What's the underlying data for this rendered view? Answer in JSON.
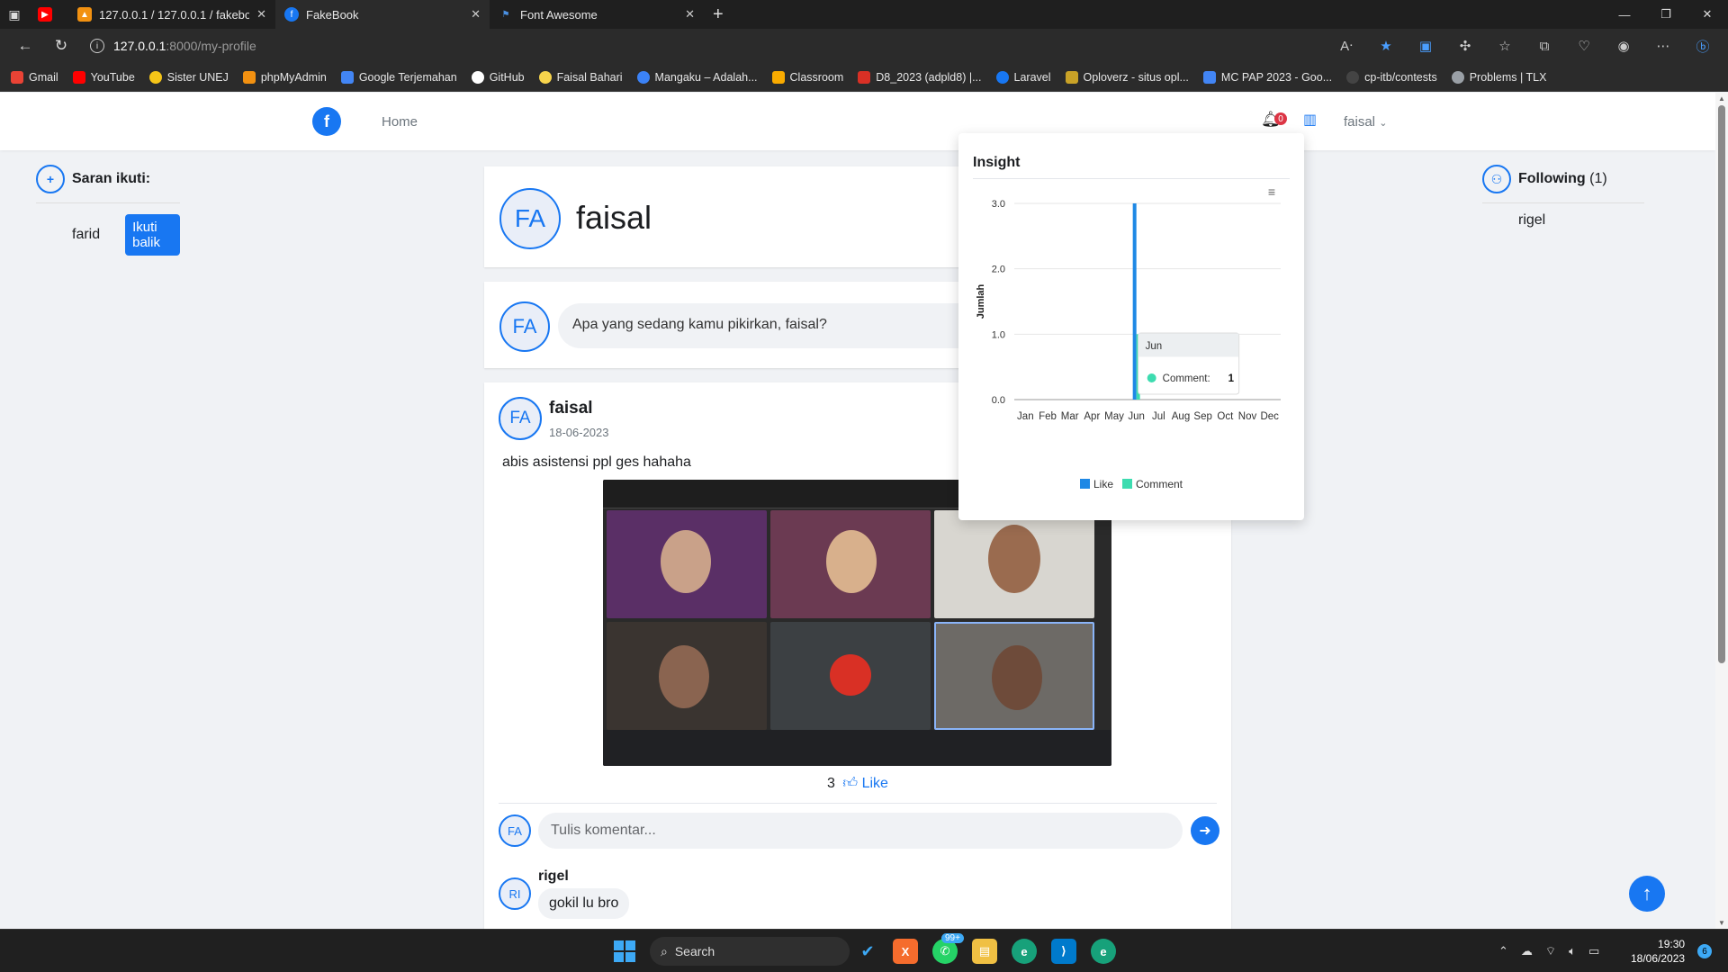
{
  "browser": {
    "tabs": [
      {
        "title": "",
        "favicon": "youtube-icon"
      },
      {
        "title": "127.0.0.1 / 127.0.0.1 / fakebook /",
        "favicon": "phpmyadmin-icon"
      },
      {
        "title": "FakeBook",
        "favicon": "fakebook-icon",
        "active": true
      },
      {
        "title": "Font Awesome",
        "favicon": "flag-icon"
      }
    ],
    "url_host": "127.0.0.1",
    "url_path": ":8000/my-profile",
    "bookmarks": [
      {
        "label": "Gmail",
        "color": "#ea4335"
      },
      {
        "label": "YouTube",
        "color": "#ff0000"
      },
      {
        "label": "Sister UNEJ",
        "color": "#f5c518"
      },
      {
        "label": "phpMyAdmin",
        "color": "#f29111"
      },
      {
        "label": "Google Terjemahan",
        "color": "#4285f4"
      },
      {
        "label": "GitHub",
        "color": "#ffffff"
      },
      {
        "label": "Faisal Bahari",
        "color": "#f7d44c"
      },
      {
        "label": "Mangaku – Adalah...",
        "color": "#3b82f6"
      },
      {
        "label": "Classroom",
        "color": "#f9ab00"
      },
      {
        "label": "D8_2023 (adpld8) |...",
        "color": "#d93025"
      },
      {
        "label": "Laravel",
        "color": "#1877f2"
      },
      {
        "label": "Oploverz - situs opl...",
        "color": "#c9a227"
      },
      {
        "label": "MC PAP 2023 - Goo...",
        "color": "#4285f4"
      },
      {
        "label": "cp-itb/contests",
        "color": "#444444"
      },
      {
        "label": "Problems | TLX",
        "color": "#9aa0a6"
      }
    ]
  },
  "navbar": {
    "home": "Home",
    "notif_count": "0",
    "user": "faisal"
  },
  "saran": {
    "title": "Saran ikuti:",
    "name": "farid",
    "button": "Ikuti balik"
  },
  "following": {
    "title": "Following",
    "count": "(1)",
    "items": [
      "rigel"
    ]
  },
  "profile": {
    "initials": "FA",
    "name": "faisal"
  },
  "compose": {
    "initials": "FA",
    "placeholder": "Apa yang sedang kamu pikirkan, faisal?"
  },
  "post": {
    "initials": "FA",
    "author": "faisal",
    "date": "18-06-2023",
    "text": "abis asistensi ppl ges hahaha",
    "likes": "3",
    "like_label": "Like",
    "comment_initials": "FA",
    "comment_placeholder": "Tulis komentar...",
    "comments": [
      {
        "initials": "RI",
        "author": "rigel",
        "text": "gokil lu bro"
      }
    ]
  },
  "insight": {
    "title": "Insight",
    "tooltip_title": "Jun",
    "tooltip_label": "Comment:",
    "tooltip_value": "1"
  },
  "chart_data": {
    "type": "bar",
    "categories": [
      "Jan",
      "Feb",
      "Mar",
      "Apr",
      "May",
      "Jun",
      "Jul",
      "Aug",
      "Sep",
      "Oct",
      "Nov",
      "Dec"
    ],
    "series": [
      {
        "name": "Like",
        "values": [
          0,
          0,
          0,
          0,
          0,
          3,
          0,
          0,
          0,
          0,
          0,
          0
        ],
        "color": "#1e88e5"
      },
      {
        "name": "Comment",
        "values": [
          0,
          0,
          0,
          0,
          0,
          1,
          0,
          0,
          0,
          0,
          0,
          0
        ],
        "color": "#3ddcb0"
      }
    ],
    "ylabel": "Jumlah",
    "ylim": [
      0,
      3
    ],
    "yticks": [
      "0.0",
      "1.0",
      "2.0",
      "3.0"
    ],
    "grid": true,
    "legend": "bottom"
  },
  "taskbar": {
    "search": "Search",
    "badge": "99+",
    "time": "19:30",
    "date": "18/06/2023",
    "notif": "6"
  }
}
